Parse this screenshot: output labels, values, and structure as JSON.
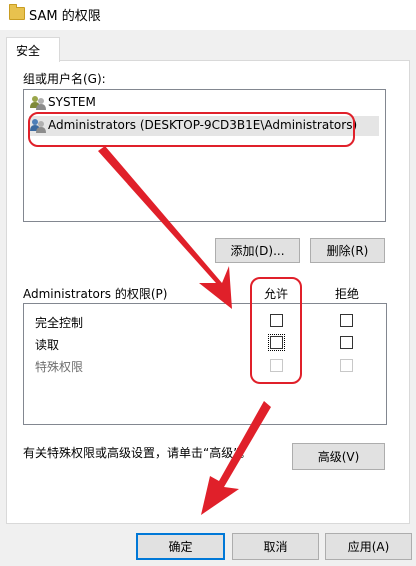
{
  "window": {
    "title": "SAM 的权限"
  },
  "tabs": [
    {
      "label": "安全"
    }
  ],
  "groups_label": "组或用户名(G):",
  "users": [
    {
      "name": "SYSTEM",
      "icon": "users-icon"
    },
    {
      "name": "Administrators (DESKTOP-9CD3B1E\\Administrators)",
      "icon": "users-icon"
    }
  ],
  "buttons": {
    "add": "添加(D)...",
    "remove": "删除(R)",
    "advanced": "高级(V)",
    "ok": "确定",
    "cancel": "取消",
    "apply": "应用(A)"
  },
  "permissions": {
    "header": "Administrators 的权限(P)",
    "allow_label": "允许",
    "deny_label": "拒绝",
    "rows": [
      {
        "name": "完全控制",
        "allow": false,
        "deny": false,
        "enabled": true
      },
      {
        "name": "读取",
        "allow": false,
        "deny": false,
        "enabled": true
      },
      {
        "name": "特殊权限",
        "allow": false,
        "deny": false,
        "enabled": false
      }
    ]
  },
  "advanced_hint": "有关特殊权限或高级设置，请单击“高级”。",
  "colors": {
    "annotation": "#e0202a",
    "focus_border": "#0078d7",
    "selected_row": "#e5e5e5"
  }
}
